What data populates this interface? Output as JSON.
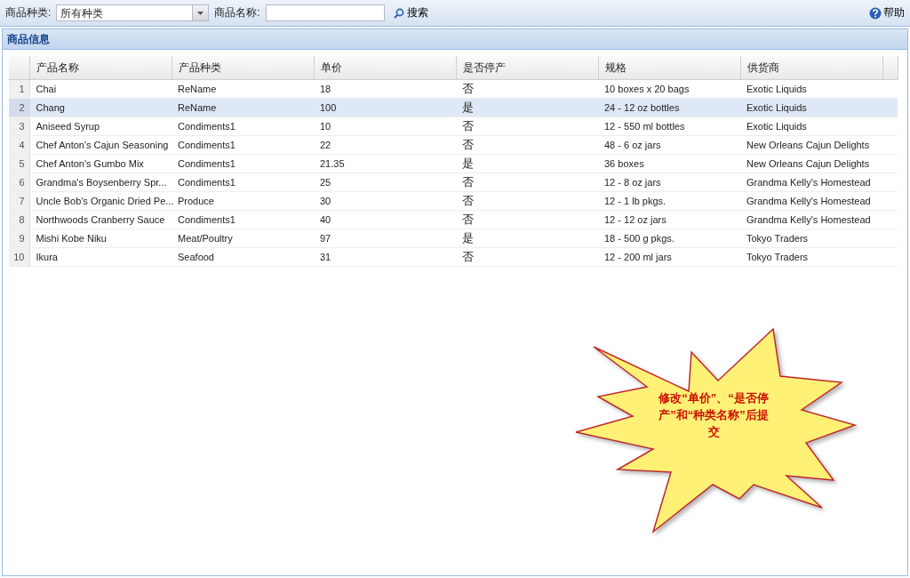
{
  "toolbar": {
    "category_label": "商品种类:",
    "category_value": "所有种类",
    "name_label": "商品名称:",
    "search_button": "搜索",
    "help_button": "帮助"
  },
  "panel": {
    "title": "商品信息"
  },
  "table": {
    "columns": [
      "产品名称",
      "产品种类",
      "单价",
      "是否停产",
      "规格",
      "供货商"
    ],
    "rows": [
      {
        "num": "1",
        "cells": [
          "Chai",
          "ReName",
          "18",
          "否",
          "10 boxes x 20 bags",
          "Exotic Liquids"
        ],
        "selected": false
      },
      {
        "num": "2",
        "cells": [
          "Chang",
          "ReName",
          "100",
          "是",
          "24 - 12 oz bottles",
          "Exotic Liquids"
        ],
        "selected": true
      },
      {
        "num": "3",
        "cells": [
          "Aniseed Syrup",
          "Condiments1",
          "10",
          "否",
          "12 - 550 ml bottles",
          "Exotic Liquids"
        ],
        "selected": false
      },
      {
        "num": "4",
        "cells": [
          "Chef Anton's Cajun Seasoning",
          "Condiments1",
          "22",
          "否",
          "48 - 6 oz jars",
          "New Orleans Cajun Delights"
        ],
        "selected": false
      },
      {
        "num": "5",
        "cells": [
          "Chef Anton's Gumbo Mix",
          "Condiments1",
          "21.35",
          "是",
          "36 boxes",
          "New Orleans Cajun Delights"
        ],
        "selected": false
      },
      {
        "num": "6",
        "cells": [
          "Grandma's Boysenberry Spr...",
          "Condiments1",
          "25",
          "否",
          "12 - 8 oz jars",
          "Grandma Kelly's Homestead"
        ],
        "selected": false
      },
      {
        "num": "7",
        "cells": [
          "Uncle Bob's Organic Dried Pe...",
          "Produce",
          "30",
          "否",
          "12 - 1 lb pkgs.",
          "Grandma Kelly's Homestead"
        ],
        "selected": false
      },
      {
        "num": "8",
        "cells": [
          "Northwoods Cranberry Sauce",
          "Condiments1",
          "40",
          "否",
          "12 - 12 oz jars",
          "Grandma Kelly's Homestead"
        ],
        "selected": false
      },
      {
        "num": "9",
        "cells": [
          "Mishi Kobe Niku",
          "Meat/Poultry",
          "97",
          "是",
          "18 - 500 g pkgs.",
          "Tokyo Traders"
        ],
        "selected": false
      },
      {
        "num": "10",
        "cells": [
          "Ikura",
          "Seafood",
          "31",
          "否",
          "12 - 200 ml jars",
          "Tokyo Traders"
        ],
        "selected": false
      }
    ]
  },
  "callout": {
    "text": "修改“单价”、“是否停产”和“种类名称”后提交"
  }
}
